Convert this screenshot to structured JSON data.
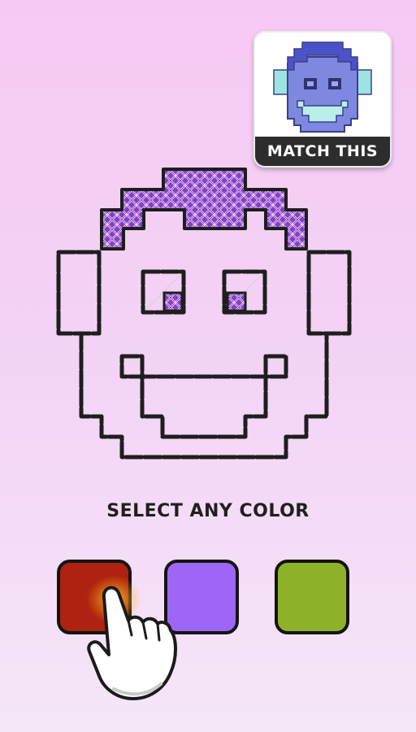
{
  "reference": {
    "label": "MATCH THIS",
    "colors": {
      "face": "#7f88e0",
      "hair": "#4c53c9",
      "ears": "#9de3df",
      "mouth": "#b9eee9",
      "outline": "#3b3f8a"
    }
  },
  "canvas": {
    "outline_color": "#1e1e1e",
    "stitched_color": "#8a3bc9",
    "stitched_dark": "#5c1f93"
  },
  "palette": {
    "title": "SELECT ANY COLOR",
    "swatches": [
      {
        "name": "red",
        "color": "#ad2210"
      },
      {
        "name": "purple",
        "color": "#9d66f6"
      },
      {
        "name": "green",
        "color": "#8eb32a"
      }
    ]
  },
  "tutorial": {
    "pointer": "hand-pointer-icon"
  }
}
